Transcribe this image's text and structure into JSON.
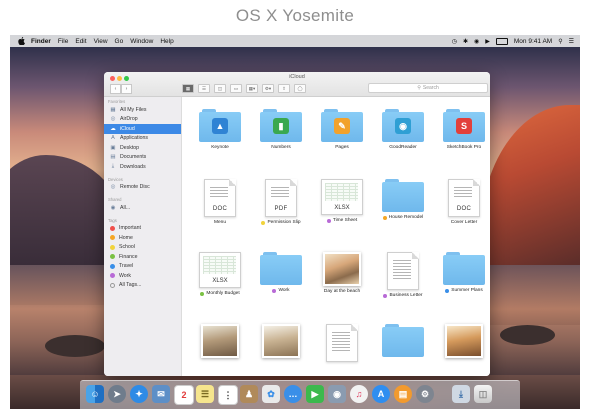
{
  "caption": "OS X Yosemite",
  "menubar": {
    "app": "Finder",
    "items": [
      "File",
      "Edit",
      "View",
      "Go",
      "Window",
      "Help"
    ],
    "clock": "Mon 9:41 AM"
  },
  "window": {
    "title": "iCloud",
    "search_placeholder": "Search"
  },
  "sidebar": {
    "favorites_header": "Favorites",
    "favorites": [
      "All My Files",
      "AirDrop",
      "iCloud",
      "Applications",
      "Desktop",
      "Documents",
      "Downloads"
    ],
    "devices_header": "Devices",
    "devices": [
      "Remote Disc"
    ],
    "shared_header": "Shared",
    "shared": [
      "All..."
    ],
    "tags_header": "Tags",
    "tags": [
      {
        "label": "Important",
        "color": "#f0504b"
      },
      {
        "label": "Home",
        "color": "#f5a623"
      },
      {
        "label": "School",
        "color": "#f1d33c"
      },
      {
        "label": "Finance",
        "color": "#7ac143"
      },
      {
        "label": "Travel",
        "color": "#3a8fe8"
      },
      {
        "label": "Work",
        "color": "#b86ad6"
      },
      {
        "label": "All Tags...",
        "color": ""
      }
    ]
  },
  "files": {
    "row1": [
      "Keynote",
      "Numbers",
      "Pages",
      "GoodReader",
      "SketchBook Pro"
    ],
    "row2": [
      {
        "label": "Menu",
        "ext": "DOC",
        "tag": ""
      },
      {
        "label": "Permission Slip",
        "ext": "PDF",
        "tag": "#f1d33c"
      },
      {
        "label": "Time Sheet",
        "ext": "XLSX",
        "tag": "#b86ad6"
      },
      {
        "label": "House Remodel",
        "ext": "",
        "tag": "#f5a623"
      },
      {
        "label": "Cover Letter",
        "ext": "DOC",
        "tag": ""
      }
    ],
    "row3": [
      {
        "label": "Monthly Budget",
        "ext": "XLSX",
        "tag": "#7ac143"
      },
      {
        "label": "Work",
        "ext": "",
        "tag": "#b86ad6"
      },
      {
        "label": "Day at the beach",
        "ext": "",
        "tag": ""
      },
      {
        "label": "Business Letter",
        "ext": "",
        "tag": "#b86ad6"
      },
      {
        "label": "Summer Plans",
        "ext": "",
        "tag": "#3a8fe8"
      }
    ]
  },
  "dock": {
    "calendar_day": "2"
  }
}
